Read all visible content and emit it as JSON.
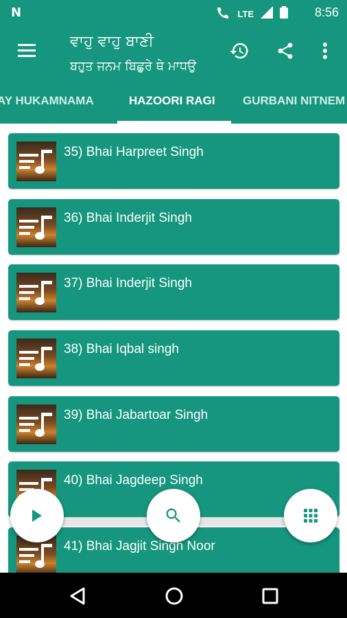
{
  "status_bar": {
    "time": "8:56",
    "network": "LTE",
    "signal_label": "4G"
  },
  "app_bar": {
    "title": "ਵਾਹੁ ਵਾਹੁ ਬਾਣੀ",
    "subtitle": "ਬਹੁਤ ਜਨਮ ਬਿਛੁਰੇ ਥੇ ਮਾਧਉ"
  },
  "tabs": [
    {
      "label": "AY HUKAMNAMA"
    },
    {
      "label": "HAZOORI RAGI"
    },
    {
      "label": "GURBANI NITNEM"
    }
  ],
  "list": {
    "items": [
      {
        "label": "35) Bhai Harpreet Singh"
      },
      {
        "label": "36) Bhai Inderjit Singh"
      },
      {
        "label": "37) Bhai Inderjit Singh"
      },
      {
        "label": "38) Bhai Iqbal singh"
      },
      {
        "label": "39) Bhai Jabartoar Singh"
      },
      {
        "label": "40) Bhai Jagdeep Singh"
      },
      {
        "label": "41) Bhai Jagjit Singh Noor"
      }
    ]
  },
  "icons": {
    "menu": "menu-icon",
    "history": "history-icon",
    "share": "share-icon",
    "more": "more-vert-icon",
    "play": "play-icon",
    "search": "search-icon",
    "grid": "grid-icon"
  },
  "colors": {
    "primary": "#16967f",
    "fab": "#ffffff"
  }
}
